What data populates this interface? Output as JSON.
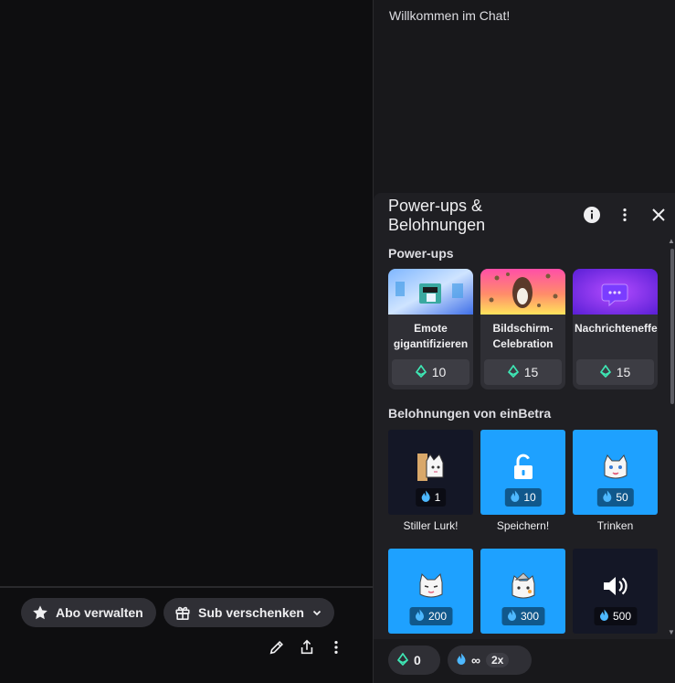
{
  "stream": {
    "abo_button": "Abo verwalten",
    "sub_button": "Sub verschenken"
  },
  "chat": {
    "welcome": "Willkommen im Chat!"
  },
  "popup": {
    "title": "Power-ups & Belohnungen",
    "powerups_heading": "Power-ups",
    "powerups": [
      {
        "label": "Emote gigantifizieren",
        "cost": "10",
        "image": "emote-gigantify-art"
      },
      {
        "label": "Bildschirm-Celebration",
        "cost": "15",
        "image": "screen-celebration-art"
      },
      {
        "label": "Nachrichteneffekte",
        "cost": "15",
        "image": "message-effects-art"
      }
    ],
    "rewards_heading": "Belohnungen von einBetra",
    "rewards": [
      {
        "label": "Stiller Lurk!",
        "cost": "1",
        "icon": "cat-lurk-icon",
        "color": "#141726"
      },
      {
        "label": "Speichern!",
        "cost": "10",
        "icon": "unlock-icon",
        "color": "#1ea1ff"
      },
      {
        "label": "Trinken",
        "cost": "50",
        "icon": "cat-drink-icon",
        "color": "#1ea1ff"
      },
      {
        "label": "",
        "cost": "200",
        "icon": "cat-face-icon",
        "color": "#1ea1ff"
      },
      {
        "label": "",
        "cost": "300",
        "icon": "cat-hat-icon",
        "color": "#1ea1ff"
      },
      {
        "label": "",
        "cost": "500",
        "icon": "speaker-icon",
        "color": "#141726"
      }
    ]
  },
  "balance": {
    "bits": "0",
    "points": "∞",
    "multiplier": "2x"
  },
  "colors": {
    "accent_blue": "#1ea1ff",
    "bits_green": "#3ee8b5",
    "points_blue": "#4db8ff"
  }
}
